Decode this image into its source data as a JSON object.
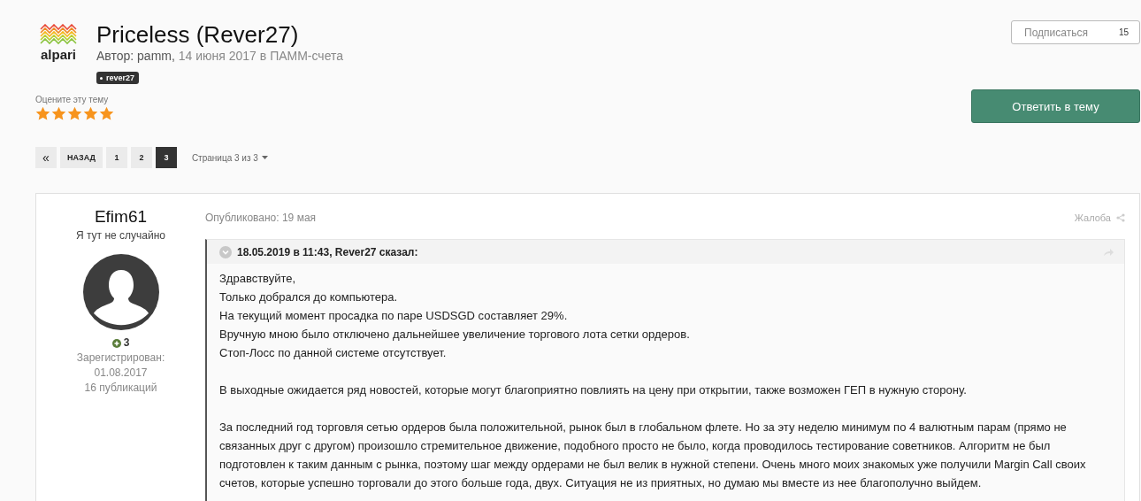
{
  "logo": {
    "text": "alpari"
  },
  "topic": {
    "title": "Priceless (Rever27)",
    "author_label": "Автор:",
    "author": "pamm,",
    "date": "14 июня 2017",
    "in_label": "в",
    "forum": "ПАММ-счета",
    "tag": "rever27"
  },
  "follow": {
    "label": "Подписаться",
    "count": "15"
  },
  "rating": {
    "label": "Оцените эту тему",
    "stars": 5
  },
  "reply_button": "Ответить в тему",
  "pagination": {
    "first": "«",
    "prev": "НАЗАД",
    "pages": [
      {
        "label": "1",
        "selected": false
      },
      {
        "label": "2",
        "selected": false
      },
      {
        "label": "3",
        "selected": true
      }
    ],
    "page_menu": "Страница 3 из 3"
  },
  "post": {
    "author": {
      "name": "Efim61",
      "title": "Я тут не случайно",
      "reputation": "3",
      "registered_label": "Зарегистрирован:",
      "registered": "01.08.2017",
      "posts": "16 публикаций"
    },
    "published": "Опубликовано: 19 мая",
    "report": "Жалоба",
    "quote": {
      "citation": "18.05.2019 в 11:43, Rever27 сказал:",
      "paragraphs": [
        [
          "Здравствуйте,",
          "Только добрался до компьютера.",
          "На текущий момент просадка по паре USDSGD  составляет 29%.",
          "Вручную мною было отключено дальнейшее увеличение торгового лота сетки ордеров.",
          "Стоп-Лосс по данной системе отсутствует."
        ],
        [
          "В выходные ожидается ряд новостей, которые могут благоприятно повлиять на цену при открытии, также возможен ГЕП в нужную сторону."
        ],
        [
          "За последний год торговля сетью ордеров была положительной, рынок был в глобальном флете. Но за эту неделю минимум по 4 валютным парам (прямо не связанных друг с другом) произошло стремительное движение, подобного просто не было, когда проводилось тестирование советников. Алгоритм не был подготовлен к таким данным с рынка, поэтому шаг между ордерами не был велик в нужной степени. Очень много моих знакомых уже получили Margin Call своих счетов, которые успешно торговали до этого больше года, двух. Ситуация не из приятных, но думаю мы вместе из нее благополучно выйдем."
        ]
      ]
    }
  }
}
